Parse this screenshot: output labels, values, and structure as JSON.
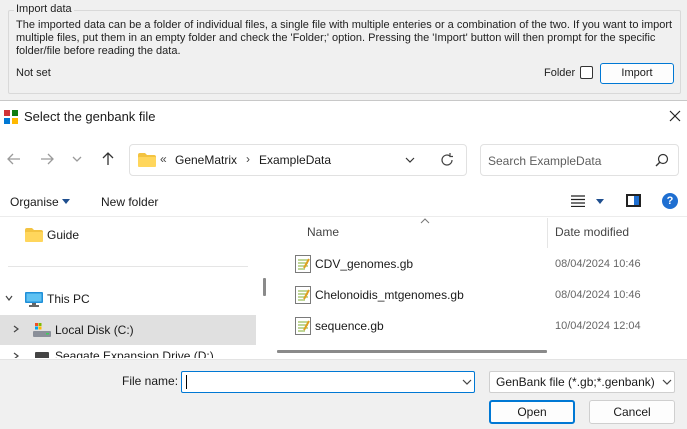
{
  "import_panel": {
    "legend": "Import data",
    "description": "The imported data can be a folder of individual files, a single file with multiple enteries or a combination of the two. If you want to import multiple files, put them in an empty folder and check the 'Folder;' option. Pressing the 'Import' button will then prompt for the specific folder/file before reading the data.",
    "status": "Not set",
    "folder_label": "Folder",
    "folder_checked": false,
    "import_button": "Import"
  },
  "dialog": {
    "title": "Select the genbank file",
    "address": {
      "overflow": "«",
      "crumbs": [
        "GeneMatrix",
        "ExampleData"
      ]
    },
    "search_placeholder": "Search ExampleData",
    "toolbar": {
      "organise": "Organise",
      "new_folder": "New folder",
      "help": "?"
    },
    "nav": {
      "items": [
        {
          "label": "Guide",
          "icon": "folder-icon"
        },
        {
          "label": "This PC",
          "icon": "monitor-icon"
        },
        {
          "label": "Local Disk (C:)",
          "icon": "drive-icon"
        },
        {
          "label": "Seagate Expansion Drive (D:)",
          "icon": "usb-drive-icon"
        }
      ]
    },
    "columns": {
      "name": "Name",
      "date": "Date modified"
    },
    "files": [
      {
        "name": "CDV_genomes.gb",
        "date": "08/04/2024 10:46"
      },
      {
        "name": "Chelonoidis_mtgenomes.gb",
        "date": "08/04/2024 10:46"
      },
      {
        "name": "sequence.gb",
        "date": "10/04/2024 12:04"
      }
    ],
    "file_name_label": "File name:",
    "file_name_value": "",
    "file_type": "GenBank file (*.gb;*.genbank)",
    "open_button": "Open",
    "cancel_button": "Cancel"
  }
}
